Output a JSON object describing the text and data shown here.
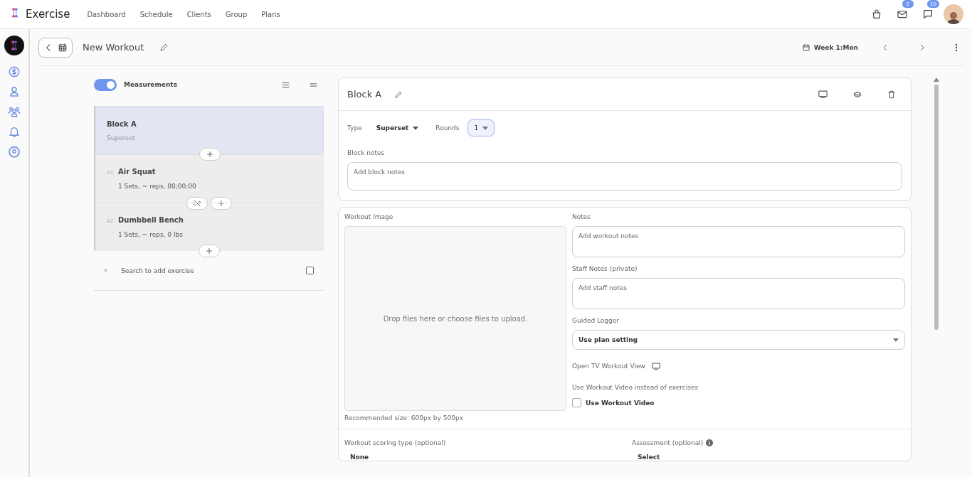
{
  "app": {
    "name": "Exercise"
  },
  "nav": [
    {
      "label": "Dashboard"
    },
    {
      "label": "Schedule"
    },
    {
      "label": "Clients"
    },
    {
      "label": "Group"
    },
    {
      "label": "Plans"
    }
  ],
  "top_icons": [
    {
      "kind": "bag"
    },
    {
      "kind": "mail",
      "badge": "2"
    },
    {
      "kind": "chat",
      "badge": "10"
    },
    {
      "kind": "avatar"
    }
  ],
  "workout": {
    "title": "New Workout",
    "week": "Week 1:Mon"
  },
  "measurements": {
    "label": "Measurements",
    "on": true
  },
  "blocks": [
    {
      "title": "Block A",
      "subtitle": "Superset",
      "selected": true,
      "exercises": [
        {
          "index": "A1",
          "name": "Air Squat",
          "detail": "1 Sets, ~ reps, 00;00;00"
        },
        {
          "index": "A2",
          "name": "Dumbbell Bench",
          "detail": "1 Sets, ~ reps, 0 lbs"
        }
      ]
    }
  ],
  "add_exercise": {
    "index": "B",
    "placeholder": "Search to add exercise",
    "checked": false
  },
  "block_editor": {
    "title": "Block A",
    "type_label": "Type",
    "type_value": "Superset",
    "rounds_label": "Rounds",
    "rounds_value": "1",
    "notes_label": "Block notes",
    "notes_placeholder": "Add block notes"
  },
  "workout_details": {
    "image_label": "Workout Image",
    "drop_text": "Drop files here or choose files to upload.",
    "recommended": "Recommended size: 600px by 500px",
    "notes_label": "Notes",
    "notes_placeholder": "Add workout notes",
    "staff_label": "Staff Notes (private)",
    "staff_placeholder": "Add staff notes",
    "logger_label": "Guided Logger",
    "logger_value": "Use plan setting",
    "tv_label": "Open TV Workout View",
    "video_label": "Use Workout Video instead of exercises",
    "video_checkbox": {
      "label": "Use Workout Video",
      "checked": false
    },
    "scoring_label": "Workout scoring type (optional)",
    "scoring_value": "None",
    "assessment_label": "Assessment (optional)",
    "assessment_value": "Select"
  }
}
